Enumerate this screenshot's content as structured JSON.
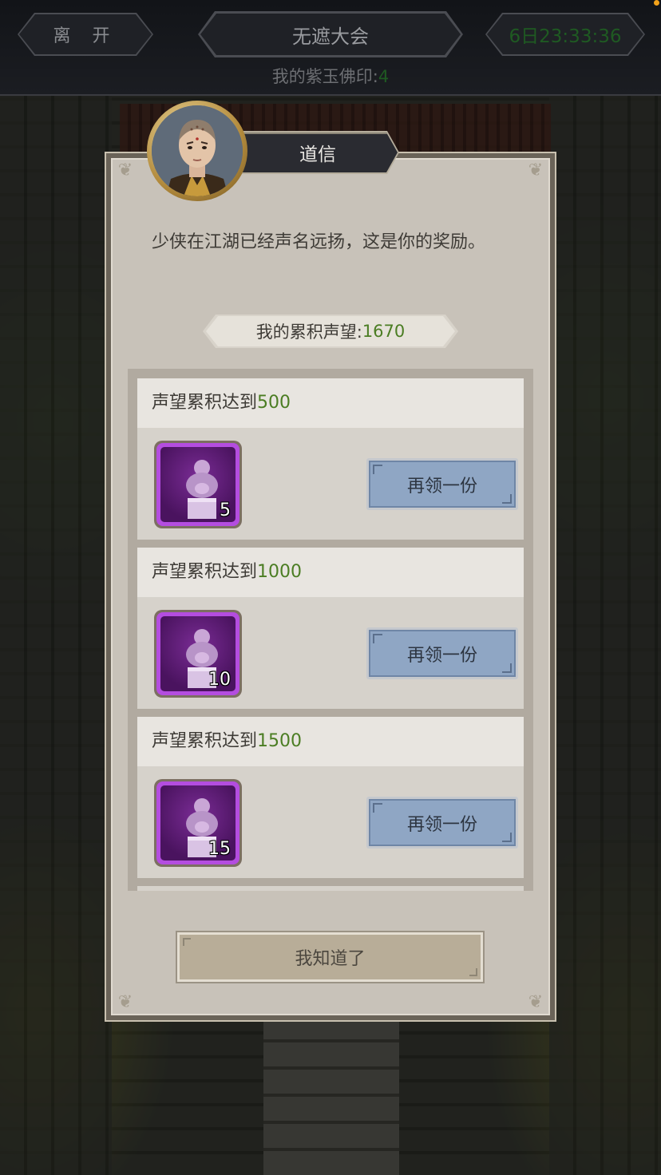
{
  "topbar": {
    "leave_label": "离 开",
    "title": "无遮大会",
    "timer": "6日23:33:36",
    "jade_label": "我的紫玉佛印:",
    "jade_value": "4"
  },
  "dialog": {
    "npc_name": "道信",
    "message": "少侠在江湖已经声名远扬，这是你的奖励。",
    "reputation_label": "我的累积声望:",
    "reputation_value": "1670",
    "tiers": [
      {
        "label": "声望累积达到",
        "threshold": "500",
        "item_icon": "jade-buddha-seal-icon",
        "quantity": "5",
        "button_label": "再领一份"
      },
      {
        "label": "声望累积达到",
        "threshold": "1000",
        "item_icon": "jade-buddha-seal-icon",
        "quantity": "10",
        "button_label": "再领一份"
      },
      {
        "label": "声望累积达到",
        "threshold": "1500",
        "item_icon": "jade-buddha-seal-icon",
        "quantity": "15",
        "button_label": "再领一份"
      }
    ],
    "confirm_label": "我知道了"
  },
  "colors": {
    "accent_green": "#4b7d23",
    "timer_green": "#1f5a22",
    "button_blue": "#8fa6c4",
    "item_purple": "#b44de0"
  }
}
